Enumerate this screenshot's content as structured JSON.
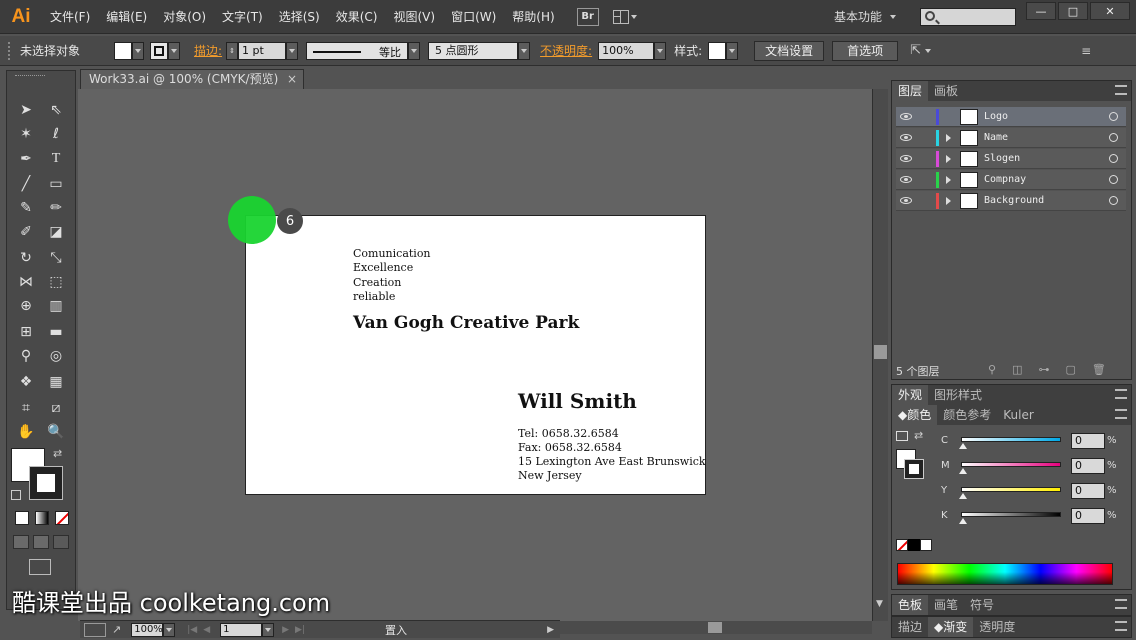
{
  "app": {
    "logo": "Ai",
    "workspace": "基本功能",
    "bridge_label": "Br"
  },
  "menu": [
    "文件(F)",
    "编辑(E)",
    "对象(O)",
    "文字(T)",
    "选择(S)",
    "效果(C)",
    "视图(V)",
    "窗口(W)",
    "帮助(H)"
  ],
  "window_buttons": {
    "minimize": "—",
    "restore": "□",
    "close": "✕"
  },
  "control_bar": {
    "selection_status": "未选择对象",
    "stroke_label": "描边:",
    "stroke_weight": "1 pt",
    "stroke_profile": "等比",
    "brush": "5 点圆形",
    "opacity_label": "不透明度:",
    "opacity_value": "100%",
    "style_label": "样式:",
    "doc_setup_button": "文档设置",
    "preferences_button": "首选项"
  },
  "document": {
    "tab_title": "Work33.ai @ 100% (CMYK/预览)",
    "tab_close": "×",
    "step_badge": "6"
  },
  "card": {
    "slogan": [
      "Comunication",
      "Excellence",
      "Creation",
      "reliable"
    ],
    "company": "Van Gogh Creative Park",
    "name": "Will Smith",
    "tel": "Tel: 0658.32.6584",
    "fax": "Fax: 0658.32.6584",
    "address1": "15 Lexington Ave East Brunswick",
    "address2": "New Jersey"
  },
  "status_bar": {
    "zoom": "100%",
    "page": "1",
    "status_text": "置入"
  },
  "layers_panel": {
    "tabs": [
      "图层",
      "画板"
    ],
    "layers": [
      {
        "name": "Logo",
        "color": "#4a4ad8"
      },
      {
        "name": "Name",
        "color": "#29d3e3"
      },
      {
        "name": "Slogen",
        "color": "#d84ad8"
      },
      {
        "name": "Compnay",
        "color": "#29d34a"
      },
      {
        "name": "Background",
        "color": "#e34a4a"
      }
    ],
    "count": "5 个图层"
  },
  "appearance_panel": {
    "tabs": [
      "外观",
      "图形样式"
    ]
  },
  "color_panel": {
    "tabs": [
      "颜色",
      "颜色参考",
      "Kuler"
    ],
    "channels": [
      {
        "label": "C",
        "value": "0",
        "unit": "%",
        "gradient": "linear-gradient(to right,#fff,#00a8e6)"
      },
      {
        "label": "M",
        "value": "0",
        "unit": "%",
        "gradient": "linear-gradient(to right,#fff,#e6007e)"
      },
      {
        "label": "Y",
        "value": "0",
        "unit": "%",
        "gradient": "linear-gradient(to right,#fff,#ffed00)"
      },
      {
        "label": "K",
        "value": "0",
        "unit": "%",
        "gradient": "linear-gradient(to right,#fff,#000)"
      }
    ]
  },
  "swatches_panel": {
    "tabs": [
      "色板",
      "画笔",
      "符号"
    ]
  },
  "stroke_panel": {
    "tabs": [
      "描边",
      "渐变",
      "透明度"
    ]
  },
  "watermark": "酷课堂出品 coolketang.com"
}
